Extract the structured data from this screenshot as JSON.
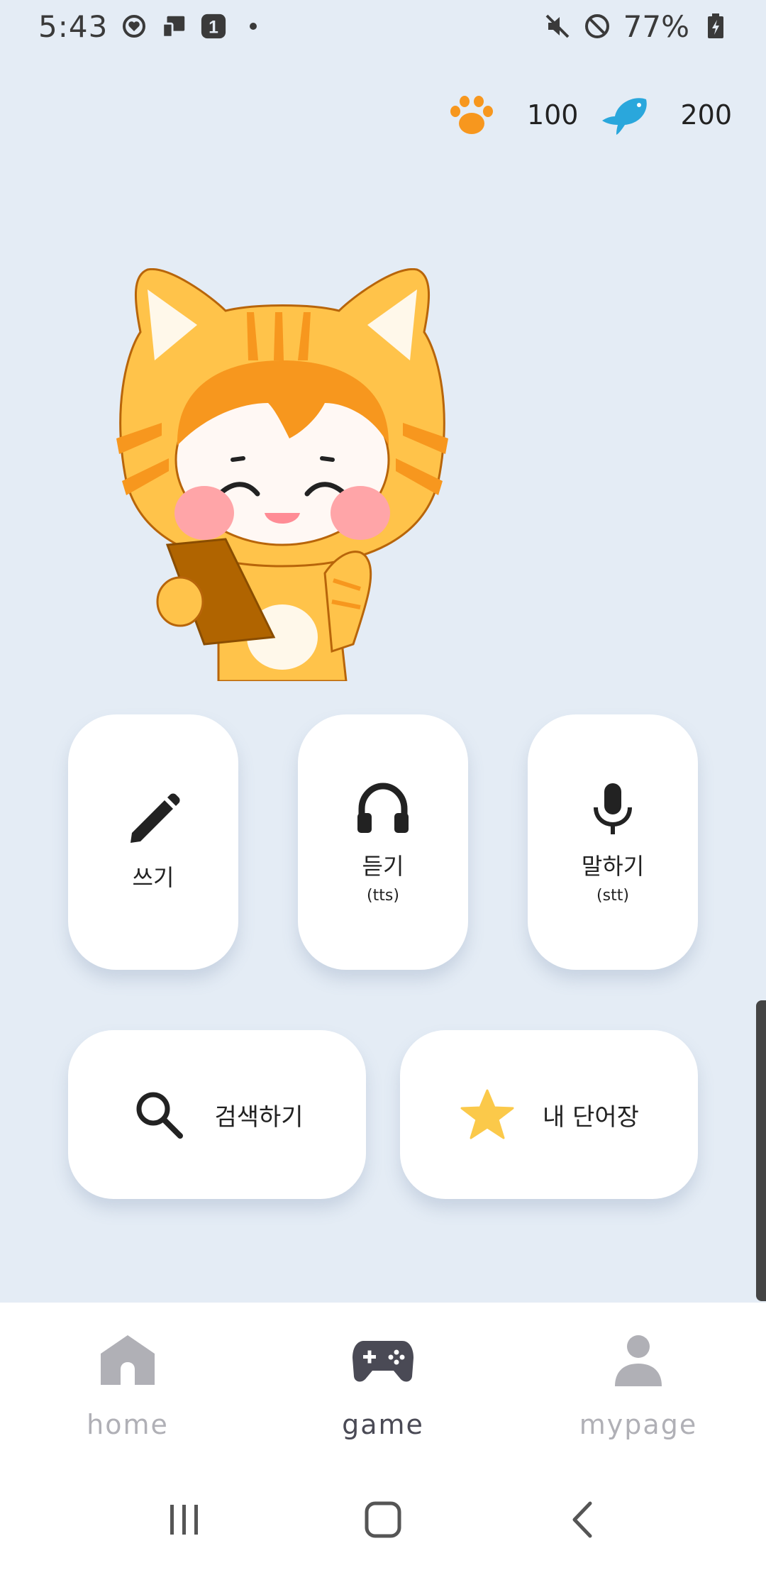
{
  "status_bar": {
    "time": "5:43",
    "battery": "77%",
    "notification_badge": "1",
    "icons": [
      "heart-circle-icon",
      "cast-icon",
      "badge-icon",
      "dot-icon",
      "mute-icon",
      "do-not-disturb-icon",
      "battery-charging-icon"
    ]
  },
  "currency": {
    "paw_value": "100",
    "fish_value": "200",
    "paw_color": "#f7971e",
    "fish_color": "#2aa7dc"
  },
  "menu": {
    "write": {
      "label": "쓰기"
    },
    "listen": {
      "label": "듣기",
      "sub": "(tts)"
    },
    "speak": {
      "label": "말하기",
      "sub": "(stt)"
    },
    "search": {
      "label": "검색하기"
    },
    "wordbook": {
      "label": "내 단어장"
    }
  },
  "bottom_nav": {
    "items": [
      {
        "label": "home",
        "icon": "home-icon",
        "active": false
      },
      {
        "label": "game",
        "icon": "gamepad-icon",
        "active": true
      },
      {
        "label": "mypage",
        "icon": "person-icon",
        "active": false
      }
    ]
  },
  "colors": {
    "background": "#e4ecf5",
    "card": "#ffffff",
    "star": "#fbc94a",
    "active_nav": "#4a4a55",
    "inactive_nav": "#b0b0b6"
  }
}
